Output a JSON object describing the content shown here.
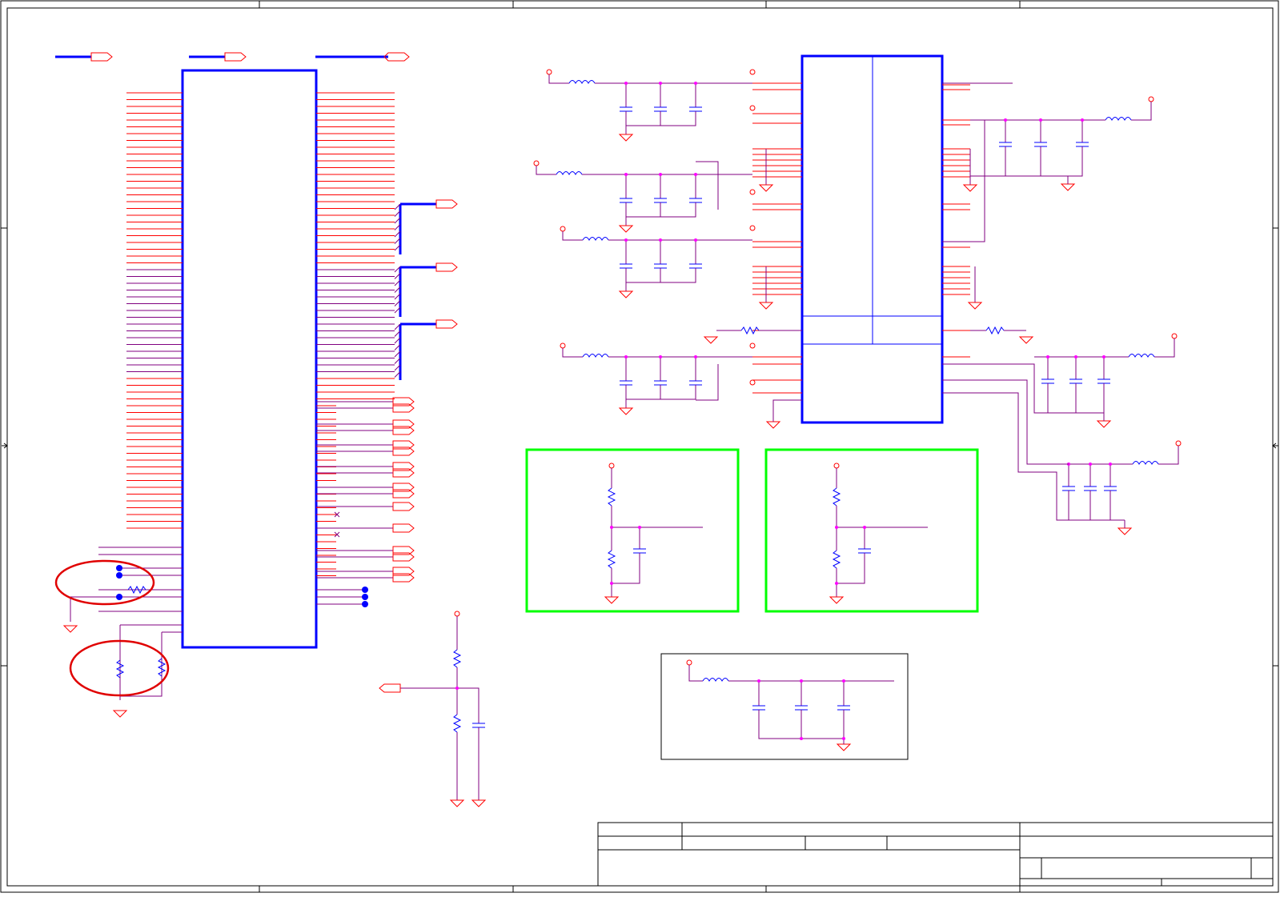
{
  "viewer": {
    "window_title": "",
    "content_type": "schematic-sheet"
  },
  "colors": {
    "background": "#ffffff",
    "frame": "#000000",
    "wire_red": "#ff0000",
    "wire_purple": "#800080",
    "component_blue": "#0000ff",
    "junction_magenta": "#ff00ff",
    "highlight_green": "#00ff00",
    "annotation_red": "#e00000"
  },
  "sheet": {
    "zone_labels": [],
    "title_block": {
      "title": "",
      "document_number": "",
      "revision": "",
      "date": "",
      "sheet": "",
      "size": ""
    },
    "annotations": []
  }
}
